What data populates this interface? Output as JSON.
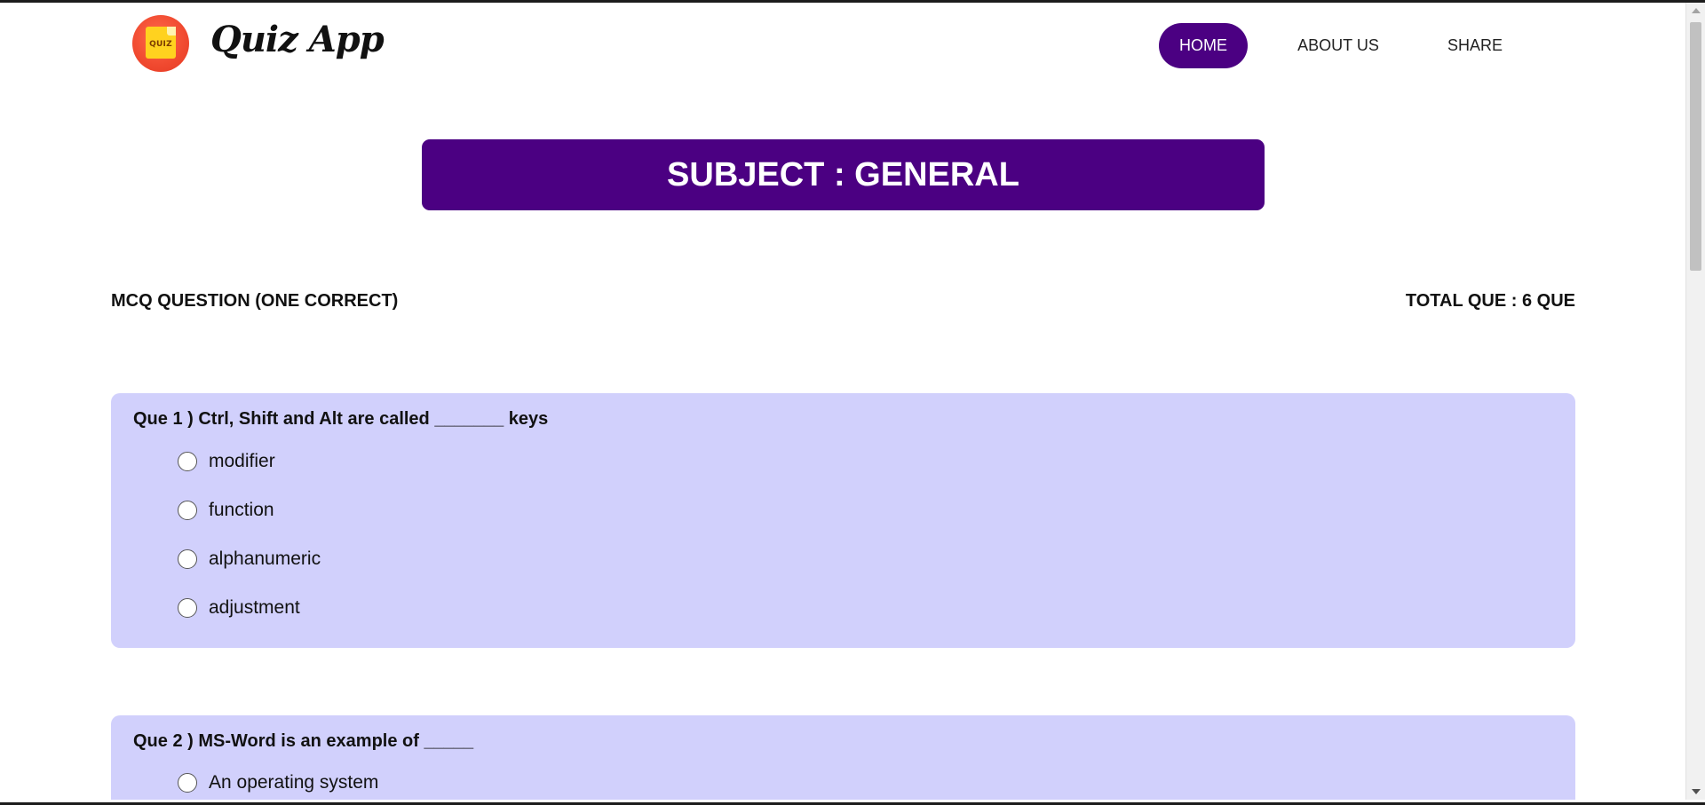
{
  "header": {
    "logo_text": "QUIZ",
    "brand": "Quiz App",
    "nav": [
      {
        "label": "HOME",
        "active": true
      },
      {
        "label": "ABOUT US",
        "active": false
      },
      {
        "label": "SHARE",
        "active": false
      }
    ]
  },
  "subject": {
    "title": "SUBJECT : GENERAL"
  },
  "meta": {
    "question_type": "MCQ QUESTION (ONE CORRECT)",
    "total": "TOTAL QUE : 6 QUE"
  },
  "questions": [
    {
      "title": "Que 1 ) Ctrl, Shift and Alt are called _______ keys",
      "options": [
        "modifier",
        "function",
        "alphanumeric",
        "adjustment"
      ]
    },
    {
      "title": "Que 2 ) MS-Word is an example of _____",
      "options": [
        "An operating system"
      ]
    }
  ],
  "colors": {
    "accent": "#4b0082",
    "card": "#d1d0fc"
  }
}
